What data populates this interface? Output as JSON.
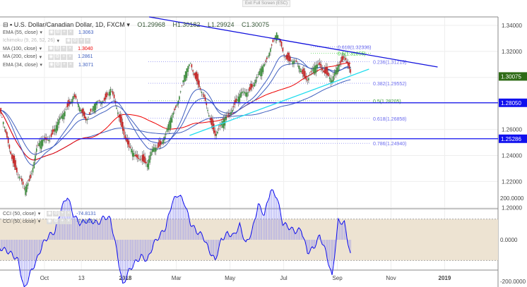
{
  "header": {
    "exit_full_screen": "Exit Full Screen (ESC)",
    "symbol": "U.S. Dollar/Canadian Dollar, 1D, FXCM",
    "open": "O1.29968",
    "high": "H1.30182",
    "low": "L1.29924",
    "close": "C1.30075"
  },
  "indicators": [
    {
      "label": "EMA (55, close)",
      "value": "1.3063",
      "color": "#3f5fbf"
    },
    {
      "label": "Ichimoku (9, 26, 52, 26)",
      "value": "",
      "color": "#aaa"
    },
    {
      "label": "MA (100, close)",
      "value": "1.3040",
      "color": "#e00"
    },
    {
      "label": "MA (200, close)",
      "value": "1.2861",
      "color": "#3f5fbf"
    },
    {
      "label": "EMA (34, close)",
      "value": "1.3071",
      "color": "#3f5fbf"
    }
  ],
  "cci_legend": [
    {
      "label": "CCI (50, close)",
      "value": "-74.8131"
    },
    {
      "label": "CCI (50, close)",
      "value": "-74.8131"
    }
  ],
  "chart_data": {
    "type": "candlestick",
    "title": "U.S. Dollar/Canadian Dollar, 1D, FXCM",
    "ylim": [
      1.2,
      1.345
    ],
    "yticks": [
      "1.34000",
      "1.32000",
      "1.30000",
      "1.28000",
      "1.26000",
      "1.24000",
      "1.22000",
      "1.20000"
    ],
    "ytick_values": [
      1.34,
      1.32,
      1.3,
      1.28,
      1.26,
      1.24,
      1.22,
      1.2
    ],
    "xticks": [
      "Oct",
      "13",
      "2018",
      "Mar",
      "May",
      "Jul",
      "Sep",
      "Nov",
      "2019"
    ],
    "xtick_days": [
      61,
      103,
      153,
      211,
      272,
      333,
      394,
      455,
      516
    ],
    "series_start_day": 10,
    "step_days": 7,
    "weekly_close": [
      1.275,
      1.255,
      1.24,
      1.225,
      1.212,
      1.225,
      1.245,
      1.25,
      1.255,
      1.26,
      1.268,
      1.28,
      1.285,
      1.275,
      1.27,
      1.275,
      1.28,
      1.285,
      1.29,
      1.275,
      1.262,
      1.245,
      1.238,
      1.24,
      1.232,
      1.245,
      1.25,
      1.255,
      1.27,
      1.285,
      1.3,
      1.31,
      1.3,
      1.285,
      1.27,
      1.258,
      1.262,
      1.27,
      1.28,
      1.285,
      1.288,
      1.295,
      1.3,
      1.31,
      1.325,
      1.332,
      1.32,
      1.315,
      1.31,
      1.305,
      1.3,
      1.305,
      1.31,
      1.305,
      1.295,
      1.31,
      1.318,
      1.3007
    ],
    "price_labels": [
      {
        "text": "1.30075",
        "value": 1.30075,
        "color": "#2e6b16"
      },
      {
        "text": "1.28050",
        "value": 1.2805,
        "color": "#1010ee"
      },
      {
        "text": "1.25286",
        "value": 1.25286,
        "color": "#1010ee"
      }
    ],
    "horizontal_lines": [
      1.2805,
      1.25286
    ],
    "trendlines": [
      {
        "name": "resistance",
        "color": "#1010dd",
        "from": [
          180,
          1.3465
        ],
        "to": [
          508,
          1.308
        ]
      },
      {
        "name": "support",
        "color": "#22ddee",
        "from": [
          226,
          1.2554
        ],
        "to": [
          430,
          1.3064
        ]
      }
    ],
    "fib_levels": [
      {
        "text": "0.236(1.31219)",
        "value": 1.31219,
        "color": "#6a6aee"
      },
      {
        "text": "0.382(1.29552)",
        "value": 1.29552,
        "color": "#6a6aee"
      },
      {
        "text": "0.5(1.28205)",
        "value": 1.28205,
        "color": "#3a9a3a"
      },
      {
        "text": "0.618(1.26858)",
        "value": 1.26858,
        "color": "#6a6aee"
      },
      {
        "text": "0.786(1.24940)",
        "value": 1.2494,
        "color": "#6a6aee"
      }
    ],
    "fib_upper": [
      {
        "text": "0.618(1.32336)",
        "value": 1.32336,
        "color": "#6a6aee"
      },
      {
        "text": "0.5(1.31855)",
        "value": 1.31855,
        "color": "#2ecc2e"
      }
    ],
    "cci": {
      "ylim": [
        -260,
        260
      ],
      "yticks": [
        "200.0000",
        "0.0000",
        "-200.0000"
      ],
      "ytick_values": [
        200,
        0,
        -200
      ],
      "band": [
        -100,
        100
      ],
      "values": [
        -40,
        -50,
        -70,
        -100,
        -240,
        -160,
        -100,
        -20,
        20,
        40,
        150,
        210,
        120,
        80,
        90,
        90,
        80,
        110,
        100,
        -50,
        -220,
        -150,
        -110,
        -80,
        -100,
        -20,
        20,
        60,
        180,
        220,
        180,
        80,
        40,
        20,
        -50,
        -100,
        0,
        30,
        20,
        70,
        -20,
        40,
        170,
        120,
        240,
        210,
        80,
        60,
        40,
        50,
        -60,
        -40,
        20,
        -60,
        -180,
        90,
        80,
        -75
      ]
    }
  }
}
